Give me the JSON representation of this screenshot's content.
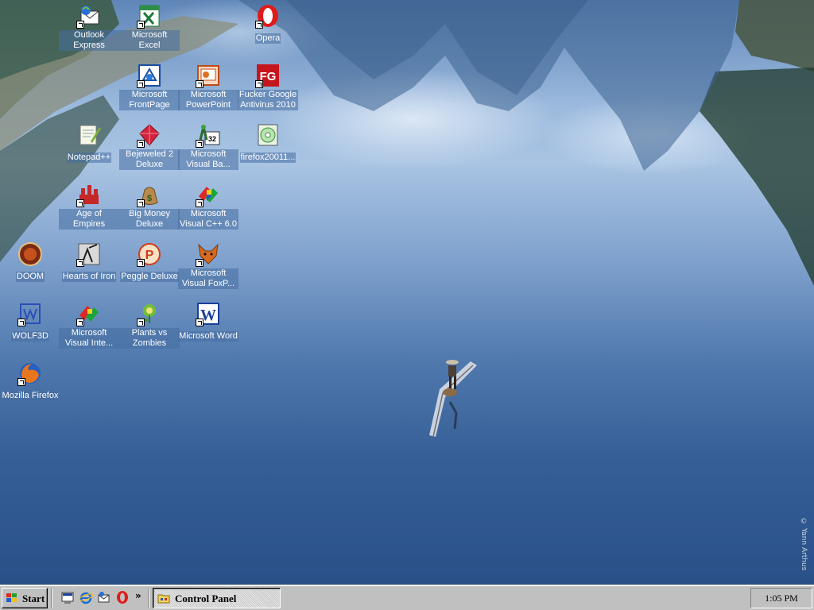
{
  "desktop": {
    "copyright": "© Yann Arthus",
    "icons": [
      {
        "name": "Outlook Express",
        "icon": "outlook-express-icon"
      },
      {
        "name": "Microsoft Excel",
        "icon": "excel-icon"
      },
      {
        "name": "Opera",
        "icon": "opera-icon"
      },
      {
        "name": "Microsoft FrontPage",
        "icon": "frontpage-icon"
      },
      {
        "name": "Microsoft PowerPoint",
        "icon": "powerpoint-icon"
      },
      {
        "name": "Fucker Google Antivirus 2010",
        "icon": "antivirus-icon"
      },
      {
        "name": "Notepad++",
        "icon": "notepad-plus-plus-icon"
      },
      {
        "name": "Bejeweled 2 Deluxe",
        "icon": "bejeweled-icon"
      },
      {
        "name": "Microsoft Visual Ba...",
        "icon": "visual-basic-icon"
      },
      {
        "name": "firefox20011...",
        "icon": "cd-installer-icon"
      },
      {
        "name": "Age of Empires",
        "icon": "age-of-empires-icon"
      },
      {
        "name": "Big Money Deluxe",
        "icon": "money-bag-icon"
      },
      {
        "name": "Microsoft Visual C++ 6.0",
        "icon": "visual-cpp-icon"
      },
      {
        "name": "DOOM",
        "icon": "doom-icon"
      },
      {
        "name": "Hearts of Iron",
        "icon": "hearts-of-iron-icon"
      },
      {
        "name": "Peggle Deluxe",
        "icon": "peggle-icon"
      },
      {
        "name": "Microsoft Visual FoxP...",
        "icon": "visual-foxpro-icon"
      },
      {
        "name": "WOLF3D",
        "icon": "wolf3d-icon"
      },
      {
        "name": "Microsoft Visual Inte...",
        "icon": "visual-interdev-icon"
      },
      {
        "name": "Plants vs Zombies",
        "icon": "plants-vs-zombies-icon"
      },
      {
        "name": "Microsoft Word",
        "icon": "word-icon"
      },
      {
        "name": "Mozilla Firefox",
        "icon": "firefox-icon"
      }
    ]
  },
  "taskbar": {
    "start_label": "Start",
    "quick_launch": [
      "show-desktop-icon",
      "internet-explorer-icon",
      "outlook-express-icon",
      "opera-icon"
    ],
    "overflow_label": "»",
    "task_button_label": "Control Panel",
    "clock": "1:05 PM"
  }
}
